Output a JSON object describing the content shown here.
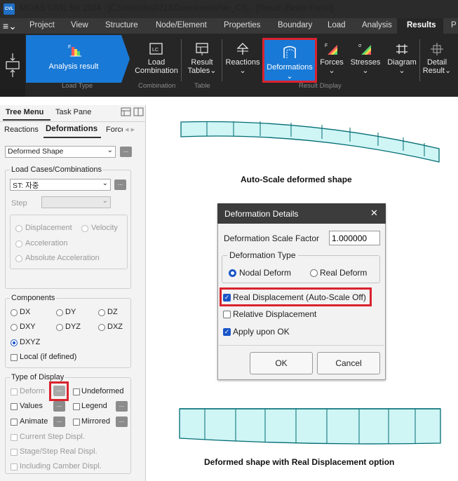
{
  "window": {
    "logo_text": "CVL",
    "title": "MIDAS CIVIL NX 2024 - [C:\\Users\\hsj0213\\Downloads\\Pier_CS] - [Result-[Beam Force]]"
  },
  "menubar": {
    "items": [
      "Project",
      "View",
      "Structure",
      "Node/Element",
      "Properties",
      "Boundary",
      "Load",
      "Analysis",
      "Results",
      "P"
    ],
    "active": "Results"
  },
  "ribbon": {
    "analysis_result": "Analysis result",
    "load_combination": [
      "Load",
      "Combination"
    ],
    "result_tables": [
      "Result",
      "Tables"
    ],
    "reactions": "Reactions",
    "deformations": "Deformations",
    "forces": "Forces",
    "stresses": "Stresses",
    "diagram": "Diagram",
    "detail_result": [
      "Detail",
      "Result"
    ],
    "group_labels": {
      "load_type": "Load Type",
      "combination": "Combination",
      "table": "Table",
      "result_display": "Result Display"
    },
    "dropdown_glyph": "⌄"
  },
  "tree_panel": {
    "tabs": [
      "Tree Menu",
      "Task Pane"
    ],
    "subtabs": [
      "Reactions",
      "Deformations",
      "Force"
    ],
    "active_subtab": "Deformations",
    "deformed_shape": "Deformed Shape",
    "load_cases_title": "Load Cases/Combinations",
    "load_case_value": "ST: 자중",
    "step_label": "Step",
    "options": [
      "Displacement",
      "Velocity",
      "Acceleration",
      "Absolute Acceleration"
    ],
    "components_title": "Components",
    "components": [
      "DX",
      "DY",
      "DZ",
      "DXY",
      "DYZ",
      "DXZ",
      "DXYZ"
    ],
    "selected_component": "DXYZ",
    "local_label": "Local (if defined)",
    "type_of_display_title": "Type of Display",
    "display": {
      "deform": "Deform",
      "undeformed": "Undeformed",
      "values": "Values",
      "legend": "Legend",
      "animate": "Animate",
      "mirrored": "Mirrored",
      "current_step": "Current Step Displ.",
      "stage_step": "Stage/Step Real Displ.",
      "camber": "Including Camber Displ."
    },
    "dots": "..."
  },
  "captions": {
    "auto_scale": "Auto-Scale deformed shape",
    "real_displacement": "Deformed shape with Real Displacement option"
  },
  "dialog": {
    "title": "Deformation Details",
    "close": "✕",
    "scale_factor_label": "Deformation Scale Factor",
    "scale_factor_value": "1.000000",
    "deformation_type_title": "Deformation Type",
    "nodal_deform": "Nodal Deform",
    "real_deform": "Real Deform",
    "selected_type": "Nodal Deform",
    "real_displacement": "Real Displacement (Auto-Scale Off)",
    "relative_displacement": "Relative Displacement",
    "apply_upon_ok": "Apply upon OK",
    "checked": {
      "real_displacement": true,
      "relative_displacement": false,
      "apply_upon_ok": true
    },
    "ok": "OK",
    "cancel": "Cancel",
    "check_glyph": "✓"
  },
  "colors": {
    "highlight": "#d9232e",
    "accent": "#1979d6",
    "beam_fill": "#cff5f5",
    "beam_stroke": "#006c73"
  }
}
